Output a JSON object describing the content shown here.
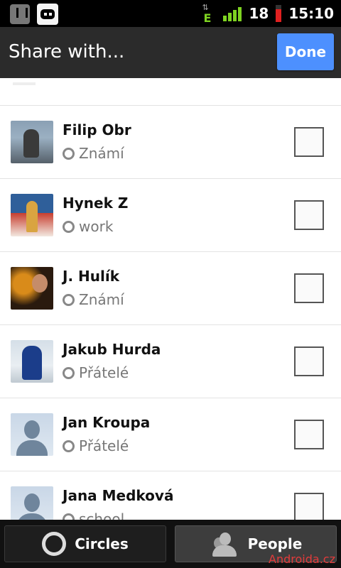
{
  "status_bar": {
    "signal_type": "E",
    "battery": "18",
    "time": "15:10"
  },
  "header": {
    "title": "Share with...",
    "done_label": "Done"
  },
  "contacts": [
    {
      "name": "Filip Obr",
      "circle": "Známí"
    },
    {
      "name": "Hynek Z",
      "circle": "work"
    },
    {
      "name": "J. Hulík",
      "circle": "Známí"
    },
    {
      "name": "Jakub Hurda",
      "circle": "Přátelé"
    },
    {
      "name": "Jan Kroupa",
      "circle": "Přátelé"
    },
    {
      "name": "Jana Medková",
      "circle": "school"
    }
  ],
  "bottom_tabs": {
    "circles_label": "Circles",
    "people_label": "People"
  },
  "watermark": "Androida.cz",
  "colors": {
    "accent": "#4d90fe",
    "signal": "#7ed321",
    "battery_low": "#e02020"
  }
}
